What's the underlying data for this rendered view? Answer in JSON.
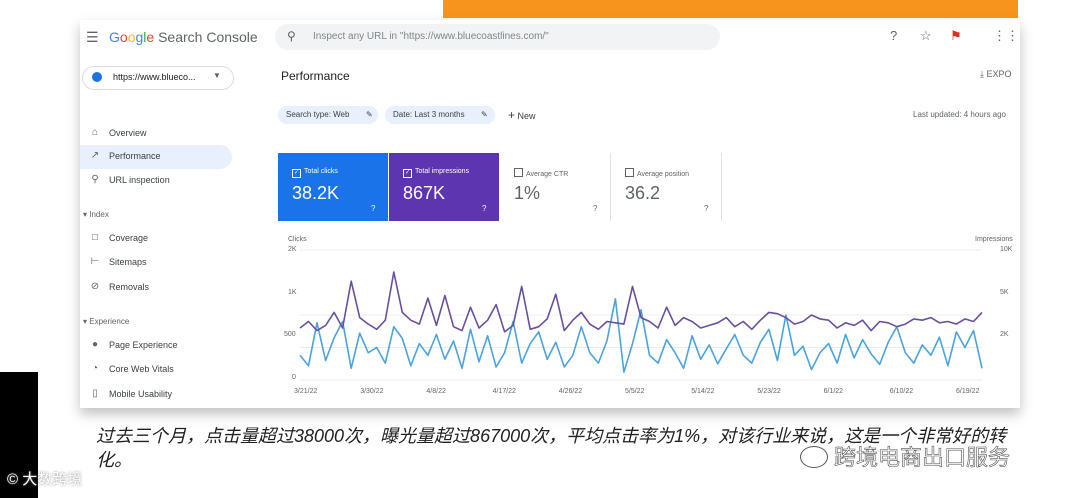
{
  "header": {
    "app_name": "Google Search Console",
    "search_placeholder": "Inspect any URL in \"https://www.bluecoastlines.com/\""
  },
  "sidebar": {
    "property": "https://www.blueco...",
    "items": [
      {
        "label": "Overview"
      },
      {
        "label": "Performance"
      },
      {
        "label": "URL inspection"
      }
    ],
    "section_index": "Index",
    "index_items": [
      {
        "label": "Coverage"
      },
      {
        "label": "Sitemaps"
      },
      {
        "label": "Removals"
      }
    ],
    "section_experience": "Experience",
    "experience_items": [
      {
        "label": "Page Experience"
      },
      {
        "label": "Core Web Vitals"
      },
      {
        "label": "Mobile Usability"
      }
    ]
  },
  "main": {
    "title": "Performance",
    "export_label": "EXPO",
    "filters": [
      {
        "label": "Search type: Web"
      },
      {
        "label": "Date: Last 3 months"
      }
    ],
    "new_label": "New",
    "last_updated": "Last updated: 4 hours ago"
  },
  "cards": [
    {
      "label": "Total clicks",
      "value": "38.2K",
      "checked": true,
      "color": "#1a73e8"
    },
    {
      "label": "Total impressions",
      "value": "867K",
      "checked": true,
      "color": "#5e35b1"
    },
    {
      "label": "Average CTR",
      "value": "1%",
      "checked": false,
      "color": "#ffffff"
    },
    {
      "label": "Average position",
      "value": "36.2",
      "checked": false,
      "color": "#ffffff"
    }
  ],
  "chart_data": {
    "type": "line",
    "x_ticks": [
      "3/21/22",
      "3/30/22",
      "4/8/22",
      "4/17/22",
      "4/26/22",
      "5/5/22",
      "5/14/22",
      "5/23/22",
      "6/1/22",
      "6/10/22",
      "6/19/22"
    ],
    "left_axis": {
      "label": "Clicks",
      "ticks": [
        "2K",
        "1K",
        "500",
        "0"
      ],
      "range": [
        0,
        2000
      ]
    },
    "right_axis": {
      "label": "Impressions",
      "ticks": [
        "10K",
        "5K",
        "2K"
      ],
      "range": [
        0,
        10000
      ]
    },
    "series": [
      {
        "name": "Total clicks",
        "color": "#4aa3df",
        "axis": "left",
        "values": [
          380,
          220,
          880,
          300,
          650,
          900,
          180,
          720,
          420,
          500,
          260,
          820,
          640,
          220,
          560,
          380,
          700,
          320,
          600,
          180,
          780,
          280,
          680,
          200,
          420,
          900,
          260,
          560,
          740,
          320,
          580,
          200,
          380,
          820,
          420,
          260,
          600,
          1250,
          120,
          560,
          1080,
          380,
          260,
          620,
          420,
          180,
          680,
          320,
          540,
          250,
          480,
          700,
          380,
          260,
          580,
          780,
          300,
          1000,
          380,
          520,
          160,
          420,
          560,
          260,
          700,
          340,
          620,
          400,
          240,
          580,
          820,
          420,
          260,
          540,
          380,
          660,
          220,
          740,
          500,
          760,
          180
        ]
      },
      {
        "name": "Total impressions",
        "color": "#6a4fa0",
        "axis": "right",
        "values": [
          4000,
          4500,
          3800,
          4200,
          5200,
          4000,
          7600,
          4800,
          4300,
          3900,
          4600,
          8300,
          5200,
          4600,
          4300,
          6300,
          4200,
          6500,
          4100,
          3800,
          5600,
          4000,
          4600,
          5800,
          3700,
          4200,
          7200,
          3900,
          4100,
          4700,
          6600,
          3800,
          4600,
          5200,
          4300,
          3900,
          4500,
          4400,
          4300,
          7200,
          4800,
          4500,
          4000,
          5600,
          4200,
          4800,
          4500,
          4000,
          4200,
          4400,
          4800,
          4100,
          4500,
          3900,
          4600,
          5200,
          5100,
          4800,
          4300,
          4500,
          5000,
          4700,
          4600,
          4000,
          4400,
          4200,
          4600,
          3800,
          4500,
          4400,
          4100,
          4300,
          4700,
          4600,
          4800,
          4400,
          4500,
          4300,
          4700,
          4500,
          5200
        ]
      }
    ]
  },
  "caption": {
    "line_text": "过去三个月，点击量超过38000次，曝光量超过867000次，平均点击率为1%，对该行业来说，这是一个非常好的转化。"
  },
  "watermarks": {
    "left": "大数跨境",
    "right": "跨境电商出口服务"
  }
}
